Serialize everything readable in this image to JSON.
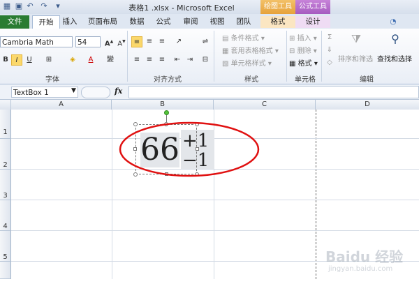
{
  "window": {
    "title": "表格1 .xlsx - Microsoft Excel",
    "context_tabs": [
      "绘图工具",
      "公式工具"
    ]
  },
  "tabs": {
    "file": "文件",
    "items": [
      "开始",
      "插入",
      "页面布局",
      "数据",
      "公式",
      "审阅",
      "视图",
      "团队",
      "格式",
      "设计"
    ],
    "active": "开始"
  },
  "ribbon": {
    "font_name": "Cambria Math",
    "font_size": "54",
    "groups": {
      "font": "字体",
      "alignment": "对齐方式",
      "styles": "样式",
      "cells": "单元格",
      "editing": "编辑"
    },
    "styles_items": [
      "条件格式",
      "套用表格格式",
      "单元格样式"
    ],
    "cells_items": [
      "插入",
      "删除",
      "格式"
    ],
    "editing_items": [
      "排序和筛选",
      "查找和选择"
    ],
    "font_buttons": [
      "B",
      "I",
      "U"
    ]
  },
  "formula_bar": {
    "name_box": "TextBox 1",
    "fx": "fx",
    "value": ""
  },
  "grid": {
    "columns": [
      "A",
      "B",
      "C",
      "D"
    ],
    "rows": [
      "1",
      "2",
      "3",
      "4",
      "5"
    ]
  },
  "equation": {
    "base": "66",
    "upper": "+1",
    "lower": "−1"
  },
  "annotation": {
    "color": "#e01010"
  },
  "watermark": {
    "logo": "Baidu 经验",
    "url": "jingyan.baidu.com"
  }
}
